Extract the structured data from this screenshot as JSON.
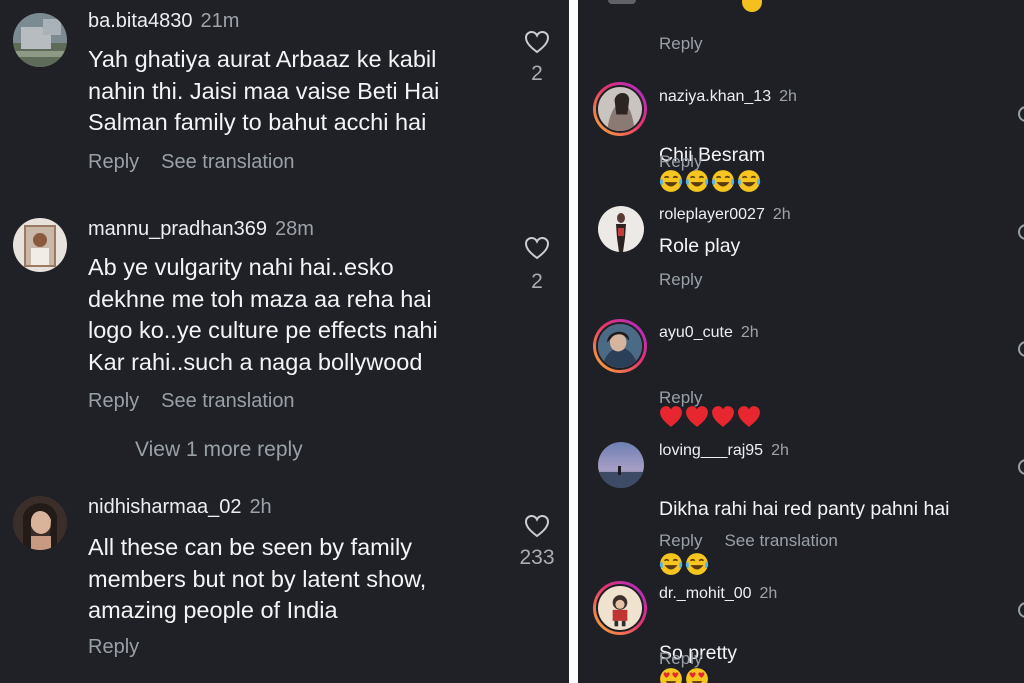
{
  "left": {
    "comments": [
      {
        "username": "ba.bita4830",
        "time": "21m",
        "text": "Yah ghatiya aurat Arbaaz ke kabil\nnahin thi.  Jaisi maa vaise Beti Hai\nSalman family to bahut acchi hai",
        "reply": "Reply",
        "translate": "See translation",
        "likes": "2"
      },
      {
        "username": "mannu_pradhan369",
        "time": "28m",
        "text": "Ab ye vulgarity nahi hai..esko\ndekhne me toh maza aa reha hai\nlogo ko..ye culture pe effects nahi\nKar rahi..such a naga bollywood",
        "reply": "Reply",
        "translate": "See translation",
        "likes": "2",
        "view_more": "View 1 more reply"
      },
      {
        "username": "nidhisharmaa_02",
        "time": "2h",
        "text": "All these can be seen by family\nmembers but not by latent show,\namazing people of India",
        "reply": "Reply",
        "likes": "233"
      }
    ]
  },
  "right": {
    "top_reply": "Reply",
    "comments": [
      {
        "username": "naziya.khan_13",
        "time": "2h",
        "text": "Chii Besram",
        "emoji": "laugh-cry",
        "emoji_count": 4,
        "reply": "Reply"
      },
      {
        "username": "roleplayer0027",
        "time": "2h",
        "text": "Role play",
        "reply": "Reply"
      },
      {
        "username": "ayu0_cute",
        "time": "2h",
        "text": "",
        "emoji": "heart",
        "emoji_count": 4,
        "reply": "Reply"
      },
      {
        "username": "loving___raj95",
        "time": "2h",
        "text": "Dikha rahi hai red panty pahni hai",
        "emoji": "laugh-cry",
        "emoji_count": 2,
        "reply": "Reply",
        "translate": "See translation"
      },
      {
        "username": "dr._mohit_00",
        "time": "2h",
        "text": "So pretty",
        "emoji": "heart-eyes",
        "emoji_count": 2,
        "reply": "Reply"
      }
    ]
  },
  "colors": {
    "background": "#1f2126",
    "text": "#f3f4f6",
    "muted": "#9aa0a8",
    "divider": "#ffffff"
  }
}
